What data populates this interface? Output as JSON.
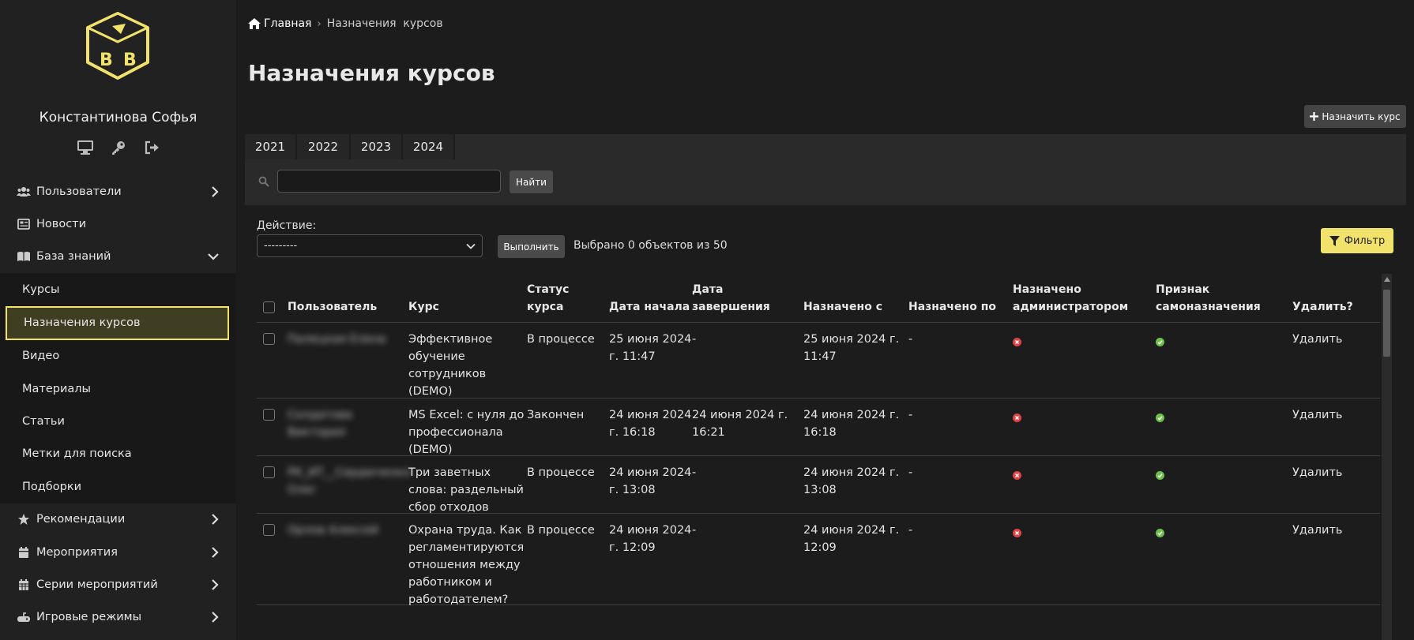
{
  "user": {
    "name": "Константинова Софья"
  },
  "colors": {
    "accent": "#f1e26c",
    "error": "#e04444",
    "success": "#6dc04a"
  },
  "sidebar": {
    "items": [
      {
        "label": "Пользователи",
        "icon": "users-icon",
        "expandable": true
      },
      {
        "label": "Новости",
        "icon": "newspaper-icon",
        "expandable": false
      },
      {
        "label": "База знаний",
        "icon": "book-icon",
        "expandable": true,
        "expanded": true
      }
    ],
    "sub_items": [
      {
        "label": "Курсы"
      },
      {
        "label": "Назначения курсов",
        "active": true
      },
      {
        "label": "Видео"
      },
      {
        "label": "Материалы"
      },
      {
        "label": "Статьи"
      },
      {
        "label": "Метки для поиска"
      },
      {
        "label": "Подборки"
      }
    ],
    "items_after": [
      {
        "label": "Рекомендации",
        "icon": "star-icon"
      },
      {
        "label": "Мероприятия",
        "icon": "calendar-icon"
      },
      {
        "label": "Серии мероприятий",
        "icon": "calendar-grid-icon"
      },
      {
        "label": "Игровые режимы",
        "icon": "gamepad-icon"
      }
    ]
  },
  "breadcrumb": {
    "home": "Главная",
    "current": "Назначения  курсов"
  },
  "page": {
    "title": "Назначения курсов",
    "assign_button": "Назначить курс"
  },
  "years": [
    "2021",
    "2022",
    "2023",
    "2024"
  ],
  "search": {
    "button": "Найти",
    "value": ""
  },
  "action": {
    "label": "Действие:",
    "selected": "---------",
    "run_button": "Выполнить",
    "selected_text": "Выбрано 0 объектов из 50"
  },
  "filter": {
    "label": "Фильтр"
  },
  "table": {
    "headers": {
      "user": "Пользователь",
      "course": "Курс",
      "status": "Статус курса",
      "start": "Дата начала",
      "end": "Дата завершения",
      "from": "Назначено с",
      "to": "Назначено по",
      "admin": "Назначено администратором",
      "self": "Признак самоназначения",
      "delete": "Удалить?"
    },
    "rows": [
      {
        "user": "Палецкая Елена",
        "course": "Эффективное обучение сотрудников (DEMO)",
        "status": "В процессе",
        "start": "25 июня 2024 г. 11:47",
        "end": "-",
        "from": "25 июня 2024 г. 11:47",
        "to": "-",
        "admin": false,
        "self": true,
        "delete": "Удалить"
      },
      {
        "user": "Солдатова Виктория",
        "course": "MS Excel: с нуля до профессионала (DEMO)",
        "status": "Закончен",
        "start": "24 июня 2024 г. 16:18",
        "end": "24 июня 2024 г. 16:21",
        "from": "24 июня 2024 г. 16:18",
        "to": "-",
        "admin": false,
        "self": true,
        "delete": "Удалить"
      },
      {
        "user": "РК_ИТ__Сердюченко Олег",
        "course": "Три заветных слова: раздельный сбор отходов",
        "status": "В процессе",
        "start": "24 июня 2024 г. 13:08",
        "end": "-",
        "from": "24 июня 2024 г. 13:08",
        "to": "-",
        "admin": false,
        "self": true,
        "delete": "Удалить"
      },
      {
        "user": "Орлов Алексей",
        "course": "Охрана труда. Как регламентируются отношения между работником и работодателем?",
        "status": "В процессе",
        "start": "24 июня 2024 г. 12:09",
        "end": "-",
        "from": "24 июня 2024 г. 12:09",
        "to": "-",
        "admin": false,
        "self": true,
        "delete": "Удалить"
      }
    ]
  }
}
